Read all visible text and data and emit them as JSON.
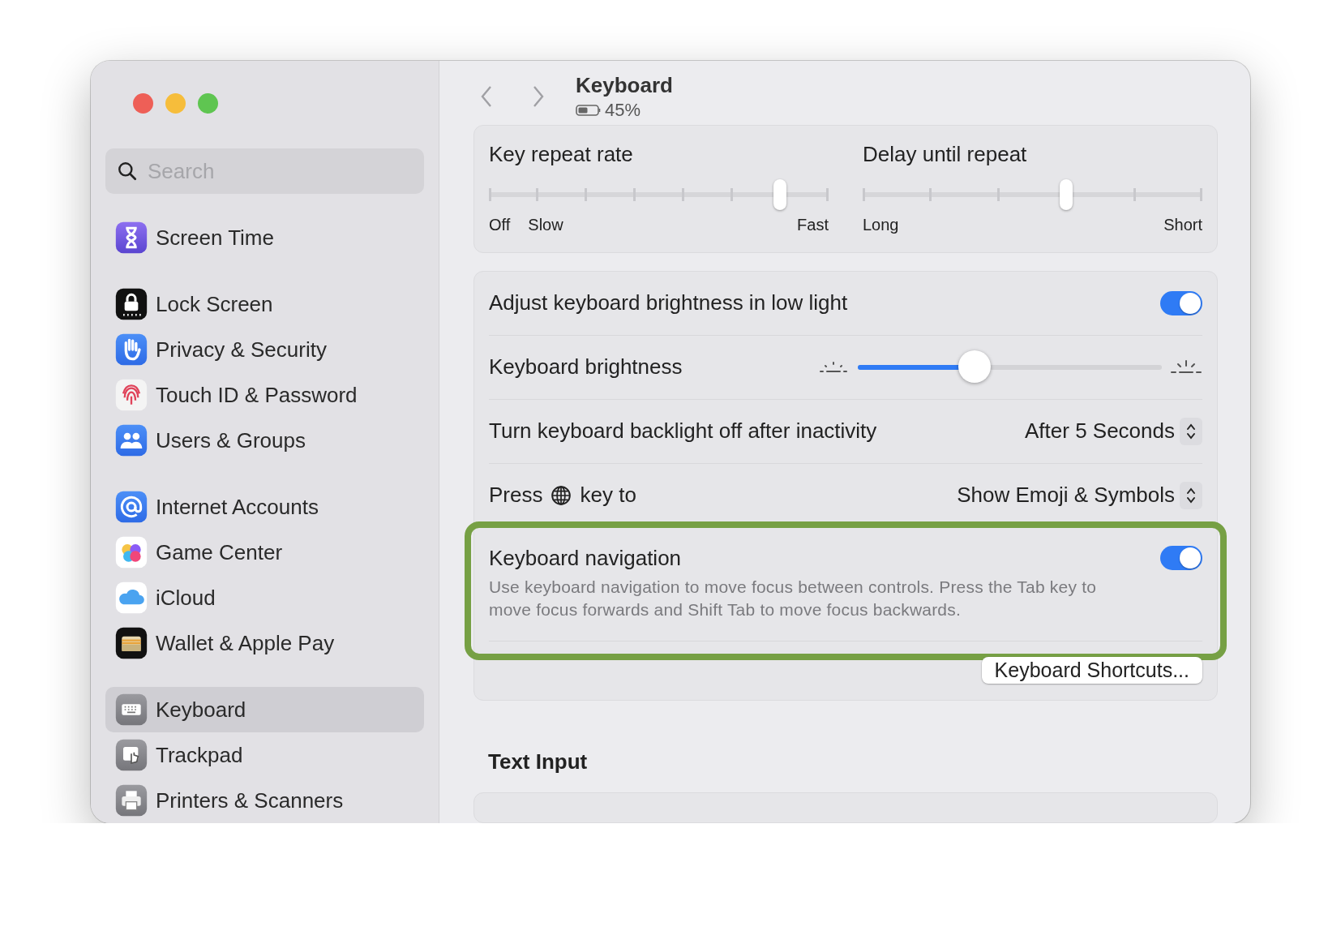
{
  "window": {
    "title": "Keyboard",
    "subtitle": "45%"
  },
  "sidebar": {
    "search": {
      "placeholder": "Search"
    },
    "groups": [
      [
        {
          "label": "Screen Time",
          "selected": false
        }
      ],
      [
        {
          "label": "Lock Screen",
          "selected": false
        },
        {
          "label": "Privacy & Security",
          "selected": false
        },
        {
          "label": "Touch ID & Password",
          "selected": false
        },
        {
          "label": "Users & Groups",
          "selected": false
        }
      ],
      [
        {
          "label": "Internet Accounts",
          "selected": false
        },
        {
          "label": "Game Center",
          "selected": false
        },
        {
          "label": "iCloud",
          "selected": false
        },
        {
          "label": "Wallet & Apple Pay",
          "selected": false
        }
      ],
      [
        {
          "label": "Keyboard",
          "selected": true
        },
        {
          "label": "Trackpad",
          "selected": false
        },
        {
          "label": "Printers & Scanners",
          "selected": false
        }
      ]
    ]
  },
  "repeat_sliders": [
    {
      "label": "Key repeat rate",
      "level": 0.857,
      "marks": [
        "Off",
        "Slow",
        "Fast"
      ]
    },
    {
      "label": "Delay until repeat",
      "level": 0.6,
      "marks": [
        "Long",
        "Short"
      ]
    }
  ],
  "settings": [
    {
      "kind": "toggle",
      "label": "Adjust keyboard brightness in low light",
      "on": true
    },
    {
      "kind": "slider",
      "label": "Keyboard brightness",
      "level": 0.385
    },
    {
      "kind": "popup",
      "label": "Turn keyboard backlight off after inactivity",
      "value": "After 5 Seconds"
    },
    {
      "kind": "popup_globe",
      "label": "Press",
      "label_after": "key to",
      "value": "Show Emoji & Symbols"
    },
    {
      "kind": "toggle_desc",
      "label": "Keyboard navigation",
      "description": "Use keyboard navigation to move focus between controls. Press the Tab key to move focus forwards and Shift Tab to move focus backwards.",
      "on": true,
      "highlighted": true
    },
    {
      "kind": "button",
      "label": "Keyboard Shortcuts..."
    }
  ],
  "section": {
    "title": "Text Input"
  }
}
